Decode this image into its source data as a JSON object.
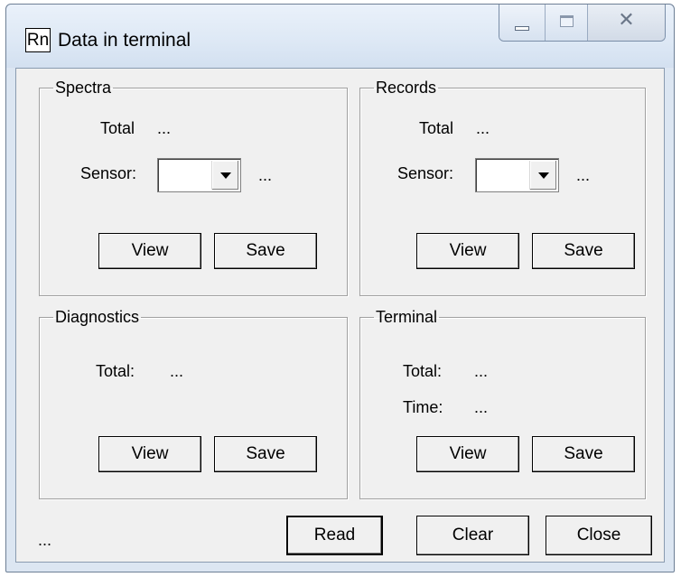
{
  "window": {
    "icon_text": "Rn",
    "title": "Data in terminal"
  },
  "spectra": {
    "title": "Spectra",
    "total_label": "Total",
    "total_value": "...",
    "sensor_label": "Sensor:",
    "sensor_value": "",
    "sensor_info": "...",
    "view_label": "View",
    "save_label": "Save"
  },
  "records": {
    "title": "Records",
    "total_label": "Total",
    "total_value": "...",
    "sensor_label": "Sensor:",
    "sensor_value": "",
    "sensor_info": "...",
    "view_label": "View",
    "save_label": "Save"
  },
  "diagnostics": {
    "title": "Diagnostics",
    "total_label": "Total:",
    "total_value": "...",
    "view_label": "View",
    "save_label": "Save"
  },
  "terminal": {
    "title": "Terminal",
    "total_label": "Total:",
    "total_value": "...",
    "time_label": "Time:",
    "time_value": "...",
    "view_label": "View",
    "save_label": "Save"
  },
  "footer": {
    "status": "...",
    "read_label": "Read",
    "clear_label": "Clear",
    "close_label": "Close"
  }
}
